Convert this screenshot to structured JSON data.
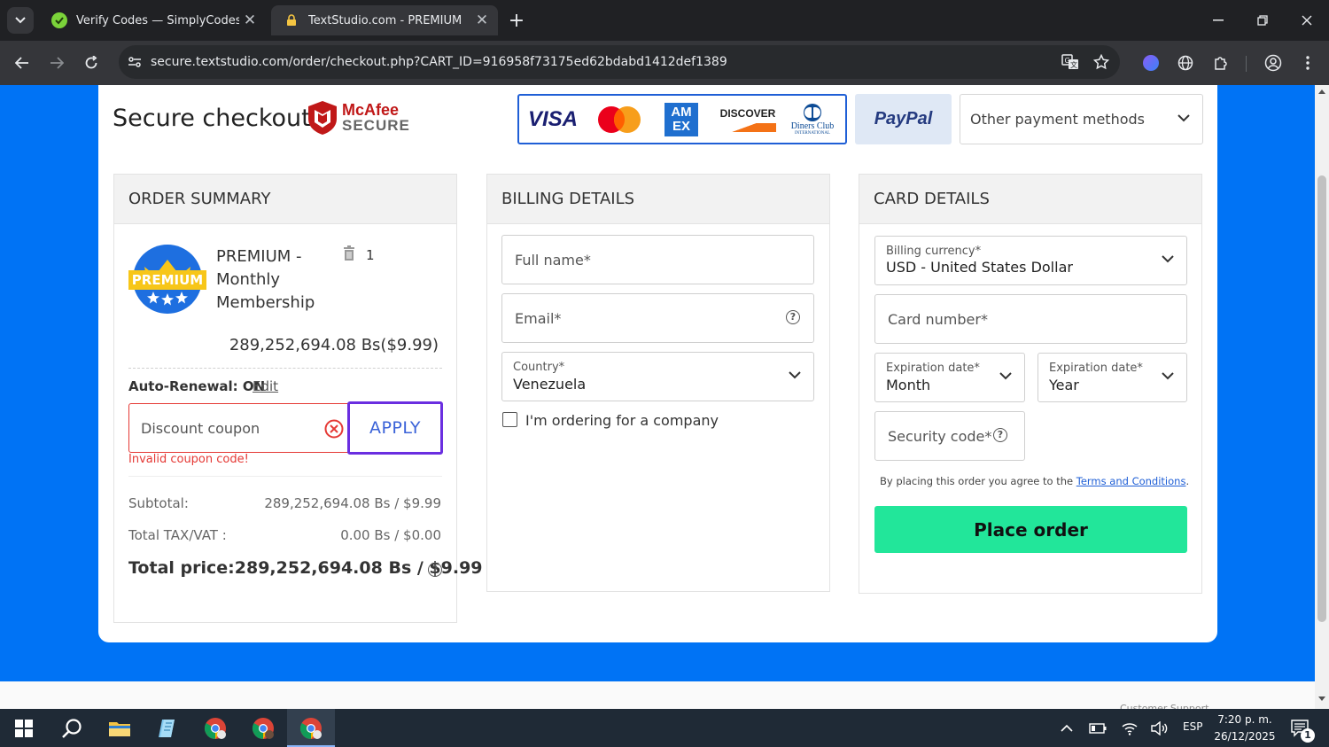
{
  "browser": {
    "tabs": [
      {
        "title": "Verify Codes — SimplyCodes"
      },
      {
        "title": "TextStudio.com - PREMIUM"
      }
    ],
    "url": "secure.textstudio.com/order/checkout.php?CART_ID=916958f73175ed62bdabd1412def1389"
  },
  "header": {
    "title": "Secure checkout",
    "mcafee_line1": "McAfee",
    "mcafee_line2": "SECURE",
    "card_logos": [
      "VISA",
      "Mastercard",
      "AMEX",
      "DISCOVER",
      "Diners Club"
    ],
    "amex_line1": "AM",
    "amex_line2": "EX",
    "discover": "DISCOVER",
    "diners_line1": "Diners Club",
    "diners_line2": "INTERNATIONAL",
    "visa": "VISA",
    "paypal": "PayPal",
    "other_methods": "Other payment methods"
  },
  "order_summary": {
    "heading": "ORDER SUMMARY",
    "badge_text": "PREMIUM",
    "product_name": "PREMIUM - Monthly Membership",
    "quantity": "1",
    "price": "289,252,694.08 Bs($9.99)",
    "auto_renewal_label": "Auto-Renewal: ON",
    "edit_link": "Edit",
    "coupon_placeholder": "Discount coupon",
    "apply_label": "APPLY",
    "coupon_error": "Invalid coupon code!",
    "subtotal_label": "Subtotal:",
    "subtotal_value": "289,252,694.08 Bs / $9.99",
    "tax_label": "Total TAX/VAT :",
    "tax_value": "0.00 Bs / $0.00",
    "total_label": "Total price:",
    "total_value": "289,252,694.08 Bs / $9.99"
  },
  "billing": {
    "heading": "BILLING DETAILS",
    "fullname_placeholder": "Full name*",
    "email_placeholder": "Email*",
    "country_label": "Country*",
    "country_value": "Venezuela",
    "company_checkbox_label": "I'm ordering for a company"
  },
  "card_details": {
    "heading": "CARD DETAILS",
    "currency_label": "Billing currency*",
    "currency_value": "USD - United States Dollar",
    "card_number_placeholder": "Card number*",
    "exp_month_label": "Expiration date*",
    "exp_month_value": "Month",
    "exp_year_label": "Expiration date*",
    "exp_year_value": "Year",
    "security_code_placeholder": "Security code*",
    "terms_text": "By placing this order you agree to the",
    "terms_link": "Terms and Conditions",
    "terms_period": ".",
    "place_order": "Place order"
  },
  "footer_peek": "Customer Support",
  "taskbar": {
    "time": "7:20 p. m.",
    "date": "26/12/2025",
    "language": "ESP",
    "notification_count": "1"
  },
  "colors": {
    "page_bg": "#0073f5",
    "apply_border": "#6a2ee0",
    "apply_text": "#3a62d8",
    "place_order": "#22e69a",
    "error": "#e53935"
  }
}
